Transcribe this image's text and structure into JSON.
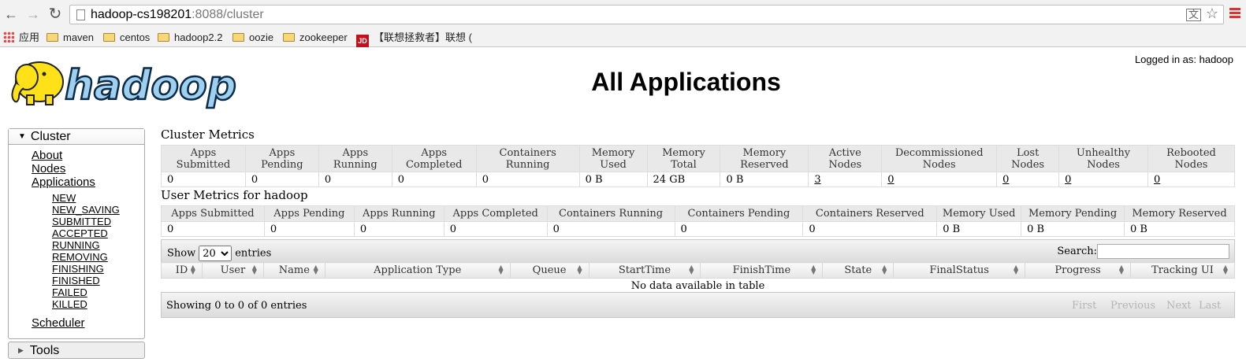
{
  "browser": {
    "back_icon": "←",
    "forward_icon": "→",
    "reload_icon": "↻",
    "url_host": "hadoop-cs198201",
    "url_rest": ":8088/cluster",
    "translate_icon": "文",
    "star_icon": "☆"
  },
  "bookmarks": [
    {
      "label": "应用"
    },
    {
      "label": "maven"
    },
    {
      "label": "centos"
    },
    {
      "label": "hadoop2.2"
    },
    {
      "label": "oozie"
    },
    {
      "label": "zookeeper"
    },
    {
      "label": "【联想拯救者】联想 ("
    }
  ],
  "jd_label": "JD",
  "header": {
    "title": "All Applications",
    "logged_in": "Logged in as: hadoop",
    "logo_text": "hadoop"
  },
  "sidebar": {
    "cluster": "Cluster",
    "about": "About",
    "nodes": "Nodes",
    "applications": "Applications",
    "states": [
      "NEW",
      "NEW_SAVING",
      "SUBMITTED",
      "ACCEPTED",
      "RUNNING",
      "REMOVING",
      "FINISHING",
      "FINISHED",
      "FAILED",
      "KILLED"
    ],
    "scheduler": "Scheduler",
    "tools": "Tools"
  },
  "cluster_metrics": {
    "title": "Cluster Metrics",
    "headers": [
      [
        "Apps",
        "Submitted"
      ],
      [
        "Apps",
        "Pending"
      ],
      [
        "Apps",
        "Running"
      ],
      [
        "Apps",
        "Completed"
      ],
      [
        "Containers",
        "Running"
      ],
      [
        "Memory",
        "Used"
      ],
      [
        "Memory",
        "Total"
      ],
      [
        "Memory",
        "Reserved"
      ],
      [
        "Active",
        "Nodes"
      ],
      [
        "Decommissioned",
        "Nodes"
      ],
      [
        "Lost",
        "Nodes"
      ],
      [
        "Unhealthy",
        "Nodes"
      ],
      [
        "Rebooted",
        "Nodes"
      ]
    ],
    "values": [
      "0",
      "0",
      "0",
      "0",
      "0",
      "0 B",
      "24 GB",
      "0 B",
      "3",
      "0",
      "0",
      "0",
      "0"
    ]
  },
  "user_metrics": {
    "title": "User Metrics for hadoop",
    "headers": [
      "Apps Submitted",
      "Apps Pending",
      "Apps Running",
      "Apps Completed",
      "Containers Running",
      "Containers Pending",
      "Containers Reserved",
      "Memory Used",
      "Memory Pending",
      "Memory Reserved"
    ],
    "values": [
      "0",
      "0",
      "0",
      "0",
      "0",
      "0",
      "0",
      "0 B",
      "0 B",
      "0 B"
    ]
  },
  "table": {
    "show": "Show",
    "entries": "entries",
    "page_size": "20",
    "search": "Search:",
    "columns": [
      "ID",
      "User",
      "Name",
      "Application Type",
      "Queue",
      "StartTime",
      "FinishTime",
      "State",
      "FinalStatus",
      "Progress",
      "Tracking UI"
    ],
    "empty": "No data available in table",
    "info": "Showing 0 to 0 of 0 entries",
    "paging": [
      "First",
      "Previous",
      "Next",
      "Last"
    ]
  }
}
